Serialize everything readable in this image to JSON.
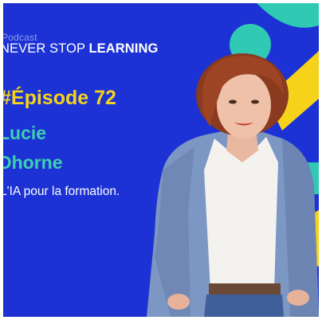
{
  "podcast_label": "Podcast",
  "show_title": {
    "regular": "NEVER STOP ",
    "bold": "LEARNING"
  },
  "episode": "#Épisode 72",
  "guest": {
    "first_name": "Lucie",
    "last_name": "Dhorne"
  },
  "topic": "L'IA pour la formation.",
  "colors": {
    "background": "#1c32d4",
    "yellow": "#f6d21a",
    "teal": "#3fcfae",
    "white": "#ffffff"
  }
}
